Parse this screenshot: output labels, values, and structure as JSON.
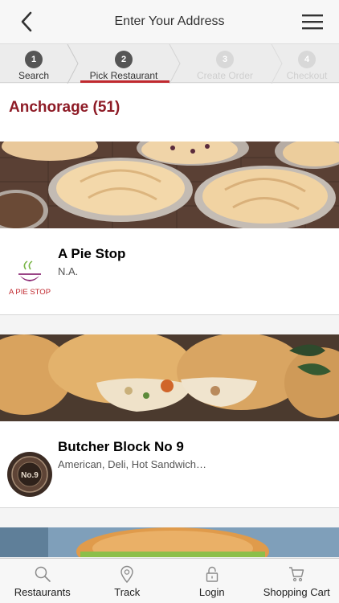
{
  "header": {
    "title": "Enter Your Address"
  },
  "steps": [
    {
      "number": "1",
      "label": "Search",
      "state": "done"
    },
    {
      "number": "2",
      "label": "Pick Restaurant",
      "state": "active"
    },
    {
      "number": "3",
      "label": "Create Order",
      "state": "todo"
    },
    {
      "number": "4",
      "label": "Checkout",
      "state": "todo"
    }
  ],
  "city": {
    "heading": "Anchorage (51)"
  },
  "restaurants": [
    {
      "name": "A Pie Stop",
      "cuisine": "N.A.",
      "logo_text": "A PIE STOP"
    },
    {
      "name": "Butcher Block No 9",
      "cuisine": "American, Deli, Hot Sandwich…",
      "logo_text": "No.9"
    }
  ],
  "tabs": [
    {
      "label": "Restaurants",
      "icon": "search-icon"
    },
    {
      "label": "Track",
      "icon": "map-pin-icon"
    },
    {
      "label": "Login",
      "icon": "lock-icon"
    },
    {
      "label": "Shopping Cart",
      "icon": "cart-icon"
    }
  ],
  "colors": {
    "accent": "#c0292f",
    "city_heading": "#8e1b26"
  }
}
